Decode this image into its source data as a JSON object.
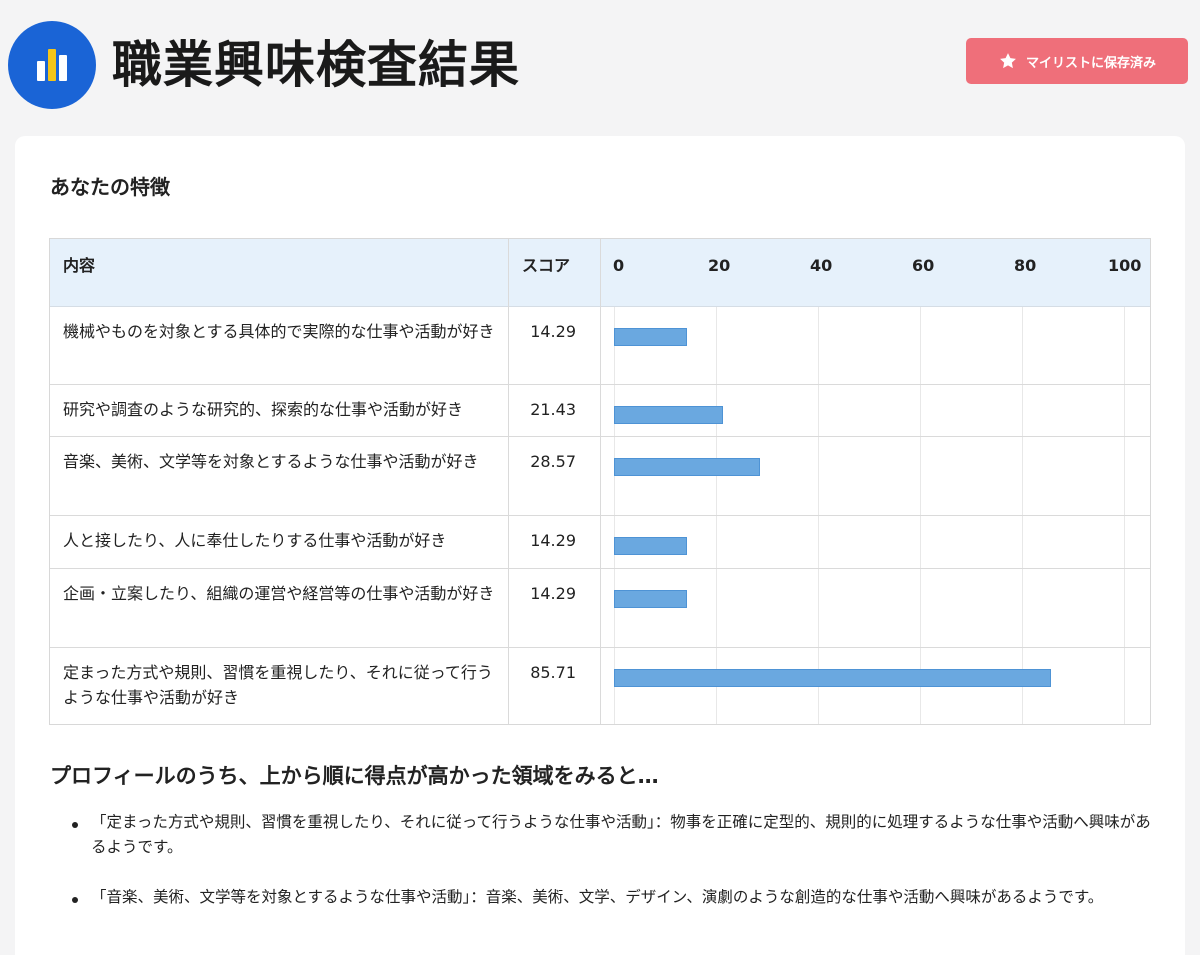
{
  "header": {
    "title": "職業興味検査結果",
    "save_button_label": "マイリストに保存済み",
    "logo_icon": "bar-chart-icon",
    "save_icon": "star-icon",
    "brand_color": "#1a64d6",
    "save_button_color": "#ef6f7a"
  },
  "section": {
    "title": "あなたの特徴"
  },
  "table": {
    "headers": {
      "content": "内容",
      "score": "スコア"
    },
    "axis_ticks": [
      "0",
      "20",
      "40",
      "60",
      "80",
      "100"
    ],
    "rows": [
      {
        "content": "機械やものを対象とする具体的で実際的な仕事や活動が好き",
        "score": "14.29",
        "value": 14.29
      },
      {
        "content": "研究や調査のような研究的、探索的な仕事や活動が好き",
        "score": "21.43",
        "value": 21.43
      },
      {
        "content": "音楽、美術、文学等を対象とするような仕事や活動が好き",
        "score": "28.57",
        "value": 28.57
      },
      {
        "content": "人と接したり、人に奉仕したりする仕事や活動が好き",
        "score": "14.29",
        "value": 14.29
      },
      {
        "content": "企画・立案したり、組織の運営や経営等の仕事や活動が好き",
        "score": "14.29",
        "value": 14.29
      },
      {
        "content": "定まった方式や規則、習慣を重視したり、それに従って行うような仕事や活動が好き",
        "score": "85.71",
        "value": 85.71
      }
    ]
  },
  "chart_data": {
    "type": "bar",
    "orientation": "horizontal",
    "categories": [
      "機械やものを対象とする具体的で実際的な仕事や活動が好き",
      "研究や調査のような研究的、探索的な仕事や活動が好き",
      "音楽、美術、文学等を対象とするような仕事や活動が好き",
      "人と接したり、人に奉仕したりする仕事や活動が好き",
      "企画・立案したり、組織の運営や経営等の仕事や活動が好き",
      "定まった方式や規則、習慣を重視したり、それに従って行うような仕事や活動が好き"
    ],
    "values": [
      14.29,
      21.43,
      28.57,
      14.29,
      14.29,
      85.71
    ],
    "xlim": [
      0,
      100
    ],
    "ticks": [
      0,
      20,
      40,
      60,
      80,
      100
    ],
    "bar_color": "#6aa8e0",
    "grid": true
  },
  "profile": {
    "title": "プロフィールのうち、上から順に得点が高かった領域をみると…",
    "items": [
      "「定まった方式や規則、習慣を重視したり、それに従って行うような仕事や活動」：物事を正確に定型的、規則的に処理するような仕事や活動へ興味があるようです。",
      "「音楽、美術、文学等を対象とするような仕事や活動」：音楽、美術、文学、デザイン、演劇のような創造的な仕事や活動へ興味があるようです。"
    ]
  }
}
